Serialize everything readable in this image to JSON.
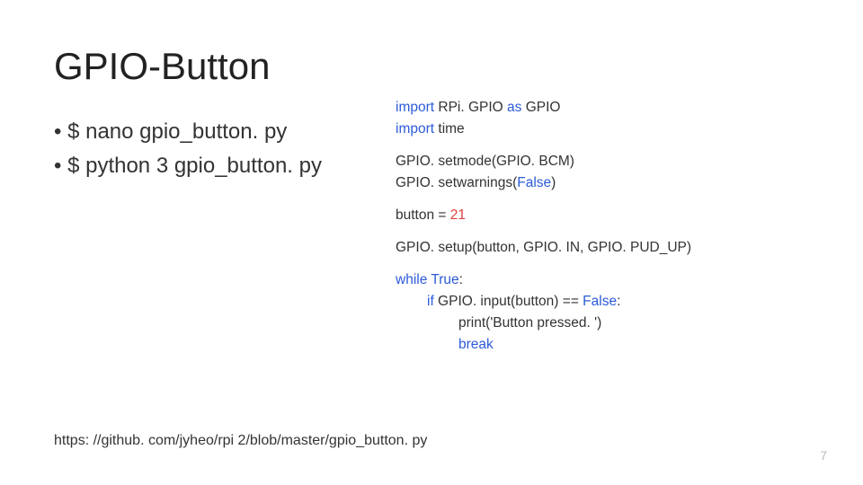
{
  "title": "GPIO-Button",
  "bullets": [
    "$ nano gpio_button. py",
    "$ python 3 gpio_button. py"
  ],
  "code": {
    "l1a": "import",
    "l1b": " RPi. GPIO ",
    "l1c": "as",
    "l1d": " GPIO",
    "l2a": "import",
    "l2b": " time",
    "l3": "GPIO. setmode(GPIO. BCM)",
    "l4a": "GPIO. setwarnings(",
    "l4b": "False",
    "l4c": ")",
    "l5a": "button = ",
    "l5b": "21",
    "l6": "GPIO. setup(button, GPIO. IN, GPIO. PUD_UP)",
    "l7a": "while",
    "l7b": " ",
    "l7c": "True",
    "l7d": ":",
    "l8a": "if",
    "l8b": " GPIO. input(button) == ",
    "l8c": "False",
    "l8d": ":",
    "l9a": "print(",
    "l9b": "'Button pressed. '",
    "l9c": ")",
    "l10": "break"
  },
  "footer_link": "https: //github. com/jyheo/rpi 2/blob/master/gpio_button. py",
  "page_number": "7"
}
